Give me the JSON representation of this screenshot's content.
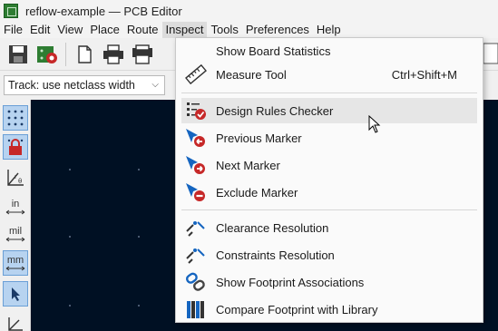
{
  "window": {
    "title": "reflow-example — PCB Editor"
  },
  "menubar": {
    "items": [
      "File",
      "Edit",
      "View",
      "Place",
      "Route",
      "Inspect",
      "Tools",
      "Preferences",
      "Help"
    ],
    "active": "Inspect"
  },
  "toolbar2": {
    "track_width": "Track: use netclass width"
  },
  "left_toolbar": {
    "in_label": "in",
    "mil_label": "mil",
    "mm_label": "mm"
  },
  "inspect_menu": {
    "items": [
      {
        "label": "Show Board Statistics",
        "icon": "board-statistics-icon",
        "shortcut": ""
      },
      {
        "label": "Measure Tool",
        "icon": "ruler-icon",
        "shortcut": "Ctrl+Shift+M"
      },
      {
        "label": "Design Rules Checker",
        "icon": "drc-checklist-icon",
        "shortcut": ""
      },
      {
        "label": "Previous Marker",
        "icon": "previous-marker-icon",
        "shortcut": ""
      },
      {
        "label": "Next Marker",
        "icon": "next-marker-icon",
        "shortcut": ""
      },
      {
        "label": "Exclude Marker",
        "icon": "exclude-marker-icon",
        "shortcut": ""
      },
      {
        "label": "Clearance Resolution",
        "icon": "clearance-icon",
        "shortcut": ""
      },
      {
        "label": "Constraints Resolution",
        "icon": "constraints-icon",
        "shortcut": ""
      },
      {
        "label": "Show Footprint Associations",
        "icon": "footprint-associations-icon",
        "shortcut": ""
      },
      {
        "label": "Compare Footprint with Library",
        "icon": "compare-library-icon",
        "shortcut": ""
      }
    ],
    "hovered": "Design Rules Checker"
  },
  "colors": {
    "canvas": "#001023",
    "marker_red": "#c62828",
    "marker_blue": "#1565c0",
    "highlight": "#e6e6e6"
  }
}
